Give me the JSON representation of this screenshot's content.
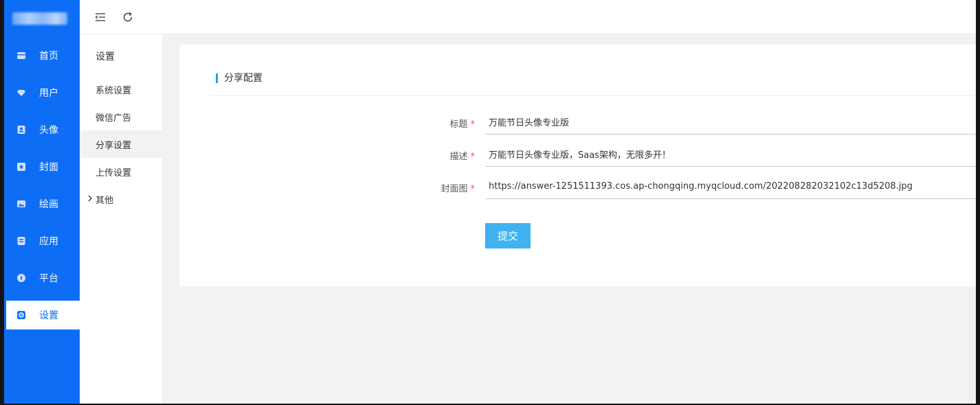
{
  "sidebar": {
    "logo": "blurred-logo",
    "items": [
      {
        "label": "首页",
        "icon": "home-icon"
      },
      {
        "label": "用户",
        "icon": "diamond-icon"
      },
      {
        "label": "头像",
        "icon": "avatar-icon"
      },
      {
        "label": "封面",
        "icon": "star-square-icon"
      },
      {
        "label": "绘画",
        "icon": "image-icon"
      },
      {
        "label": "应用",
        "icon": "app-icon"
      },
      {
        "label": "平台",
        "icon": "compass-icon"
      },
      {
        "label": "设置",
        "icon": "gear-icon",
        "active": true
      }
    ]
  },
  "topbar": {
    "collapse_icon": "menu-collapse-icon",
    "refresh_icon": "refresh-icon"
  },
  "submenu": {
    "title": "设置",
    "items": [
      {
        "label": "系统设置"
      },
      {
        "label": "微信广告"
      },
      {
        "label": "分享设置",
        "active": true
      },
      {
        "label": "上传设置"
      },
      {
        "label": "其他",
        "collapsible": true
      }
    ]
  },
  "form": {
    "title": "分享配置",
    "fields": [
      {
        "label": "标题",
        "required": "*",
        "value": "万能节日头像专业版"
      },
      {
        "label": "描述",
        "required": "*",
        "value": "万能节日头像专业版，Saas架构，无限多开！"
      },
      {
        "label": "封面图",
        "required": "*",
        "value": "https://answer-1251511393.cos.ap-chongqing.myqcloud.com/202208282032102c13d5208.jpg"
      }
    ],
    "submit_label": "提交"
  },
  "colors": {
    "sidebar_bg": "#0d6ef5",
    "accent": "#1ea0f2",
    "button_bg": "#40b2f0",
    "required": "#ff4d4f"
  }
}
